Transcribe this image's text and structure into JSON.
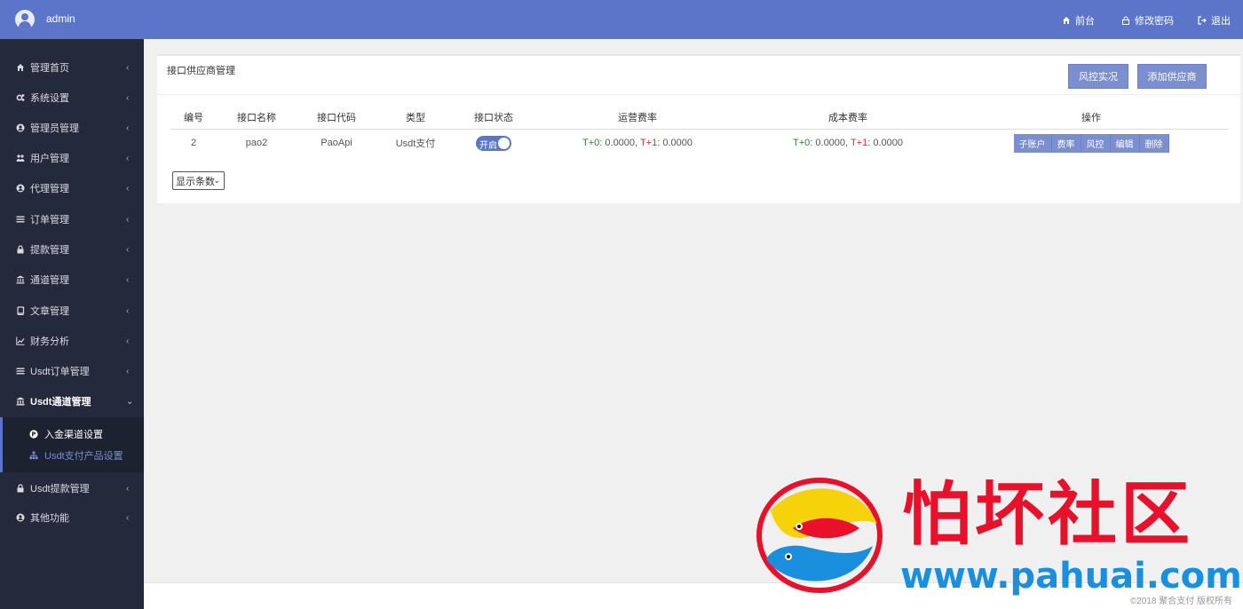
{
  "header": {
    "username": "admin",
    "nav": [
      {
        "label": "前台",
        "icon": "home-icon"
      },
      {
        "label": "修改密码",
        "icon": "lock-icon"
      },
      {
        "label": "退出",
        "icon": "logout-icon"
      }
    ]
  },
  "sidebar": {
    "items": [
      {
        "label": "管理首页",
        "icon": "home-icon"
      },
      {
        "label": "系统设置",
        "icon": "gears-icon"
      },
      {
        "label": "管理员管理",
        "icon": "user-circle-icon"
      },
      {
        "label": "用户管理",
        "icon": "users-icon"
      },
      {
        "label": "代理管理",
        "icon": "user-circle-icon"
      },
      {
        "label": "订单管理",
        "icon": "list-icon"
      },
      {
        "label": "提款管理",
        "icon": "lock-icon"
      },
      {
        "label": "通道管理",
        "icon": "bank-icon"
      },
      {
        "label": "文章管理",
        "icon": "book-icon"
      },
      {
        "label": "财务分析",
        "icon": "chart-line-icon"
      },
      {
        "label": "Usdt订单管理",
        "icon": "list-icon"
      },
      {
        "label": "Usdt通道管理",
        "icon": "bank-icon"
      },
      {
        "label": "Usdt提款管理",
        "icon": "lock-icon"
      },
      {
        "label": "其他功能",
        "icon": "user-circle-icon"
      }
    ],
    "subitems": [
      {
        "label": "入金渠道设置",
        "icon": "paypal-icon"
      },
      {
        "label": "Usdt支付产品设置",
        "icon": "sitemap-icon"
      }
    ]
  },
  "main": {
    "title": "接口供应商管理",
    "buttons": {
      "risk": "风控实况",
      "add": "添加供应商"
    },
    "table": {
      "headers": [
        "编号",
        "接口名称",
        "接口代码",
        "类型",
        "接口状态",
        "运营费率",
        "成本费率",
        "操作"
      ],
      "rows": [
        {
          "id": "2",
          "name": "pao2",
          "code": "PaoApi",
          "type": "Usdt支付",
          "status": "开启",
          "op_t0_label": "T+0:",
          "op_t0": "0.0000,",
          "op_t1_label": "T+1:",
          "op_t1": "0.0000",
          "cost_t0_label": "T+0:",
          "cost_t0": "0.0000,",
          "cost_t1_label": "T+1:",
          "cost_t1": "0.0000",
          "actions": [
            "子账户",
            "费率",
            "风控",
            "编辑",
            "删除"
          ]
        }
      ]
    },
    "page_size_select": "显示条数"
  },
  "footer": {
    "copyright": "©2018 聚合支付 版权所有"
  },
  "watermark": {
    "title": "怕坏社区",
    "url": "www.pahuai.com"
  },
  "colors": {
    "header": "#5d75c9",
    "sidebar": "#242a3b",
    "button": "#7b8ed0",
    "rate_green": "#2e7d32",
    "rate_red": "#d32f2f",
    "watermark_red": "#e8102a",
    "watermark_blue": "#1a8fde"
  }
}
